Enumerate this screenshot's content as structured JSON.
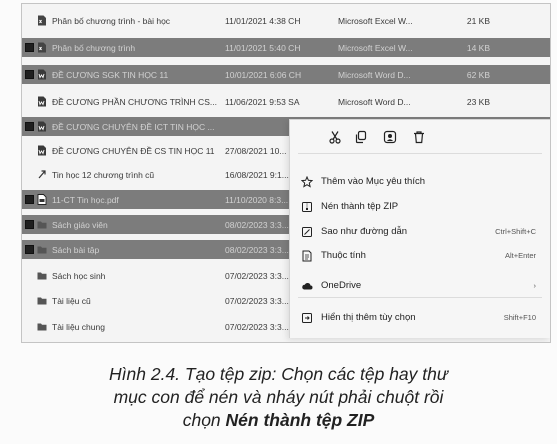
{
  "files": [
    {
      "name": "Phân bố chương trình - bài học",
      "date": "11/01/2021 4:38 CH",
      "type": "Microsoft Excel W...",
      "size": "21 KB",
      "selected": false,
      "icon": "excel-file-icon"
    },
    {
      "name": "Phân bố chương trình",
      "date": "11/01/2021 5:40 CH",
      "type": "Microsoft Excel W...",
      "size": "14 KB",
      "selected": true,
      "icon": "excel-file-icon"
    },
    {
      "name": "ĐỀ CƯƠNG SGK TIN HỌC 11",
      "date": "10/01/2021 6:06 CH",
      "type": "Microsoft Word D...",
      "size": "62 KB",
      "selected": true,
      "icon": "word-file-icon"
    },
    {
      "name": "ĐỀ CƯƠNG PHẦN CHƯƠNG TRÌNH CS...",
      "date": "11/06/2021 9:53 SA",
      "type": "Microsoft Word D...",
      "size": "23 KB",
      "selected": false,
      "icon": "word-file-icon"
    },
    {
      "name": "ĐỀ CƯƠNG CHUYÊN ĐỀ ICT TIN HỌC ...",
      "date": "",
      "type": "",
      "size": "",
      "selected": true,
      "icon": "word-file-icon"
    },
    {
      "name": "ĐỀ CƯƠNG CHUYÊN ĐỀ CS TIN HỌC 11",
      "date": "27/08/2021 10...",
      "type": "",
      "size": "",
      "selected": false,
      "icon": "word-file-icon"
    },
    {
      "name": "Tin học 12 chương trình cũ",
      "date": "16/08/2021 9:1...",
      "type": "",
      "size": "",
      "selected": false,
      "icon": "shortcut-icon"
    },
    {
      "name": "11-CT Tin học.pdf",
      "date": "11/10/2020 8:3...",
      "type": "",
      "size": "",
      "selected": true,
      "icon": "pdf-file-icon"
    },
    {
      "name": "Sách giáo viên",
      "date": "08/02/2023 3:3...",
      "type": "",
      "size": "",
      "selected": true,
      "icon": "folder-icon"
    },
    {
      "name": "Sách bài tập",
      "date": "08/02/2023 3:3...",
      "type": "",
      "size": "",
      "selected": true,
      "icon": "folder-icon"
    },
    {
      "name": "Sách học sinh",
      "date": "07/02/2023 3:3...",
      "type": "",
      "size": "",
      "selected": false,
      "icon": "folder-icon"
    },
    {
      "name": "Tài liệu cũ",
      "date": "07/02/2023 3:3...",
      "type": "",
      "size": "",
      "selected": false,
      "icon": "folder-icon"
    },
    {
      "name": "Tài liệu chung",
      "date": "07/02/2023 3:3...",
      "type": "",
      "size": "",
      "selected": false,
      "icon": "folder-icon"
    }
  ],
  "context_menu": {
    "toolbar_icons": [
      "cut-icon",
      "copy-icon",
      "share-icon",
      "delete-icon"
    ],
    "items": [
      {
        "label": "Thêm vào Mục yêu thích",
        "shortcut": "",
        "icon": "star-icon"
      },
      {
        "label": "Nén thành tệp ZIP",
        "shortcut": "",
        "icon": "zip-icon"
      },
      {
        "label": "Sao như đường dẫn",
        "shortcut": "Ctrl+Shift+C",
        "icon": "copy-path-icon"
      },
      {
        "label": "Thuộc tính",
        "shortcut": "Alt+Enter",
        "icon": "properties-icon"
      },
      {
        "label": "OneDrive",
        "shortcut": "›",
        "icon": "cloud-icon"
      },
      {
        "label": "Hiển thị thêm tùy chọn",
        "shortcut": "Shift+F10",
        "icon": "more-options-icon"
      }
    ]
  },
  "caption": {
    "line1": "Hình 2.4. Tạo tệp zip: Chọn các tệp hay thư",
    "line2": "mục con để nén và nháy nút phải chuột rồi",
    "line3_prefix": "chọn ",
    "line3_bold": "Nén thành tệp ZIP"
  },
  "colors": {
    "selected_row": "#7c7c7c",
    "menu_bg": "#f6f6f6",
    "window_bg": "#f4f4f4"
  }
}
